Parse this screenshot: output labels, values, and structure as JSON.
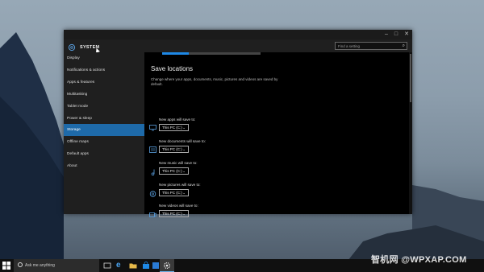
{
  "window": {
    "title": "SYSTEM",
    "buttons": {
      "minimize": "–",
      "maximize": "□",
      "close": "✕"
    },
    "search_placeholder": "Find a setting"
  },
  "sidebar": {
    "items": [
      {
        "label": "Display"
      },
      {
        "label": "Notifications & actions"
      },
      {
        "label": "Apps & features"
      },
      {
        "label": "Multitasking"
      },
      {
        "label": "Tablet mode"
      },
      {
        "label": "Power & sleep"
      },
      {
        "label": "Storage",
        "active": true
      },
      {
        "label": "Offline maps"
      },
      {
        "label": "Default apps"
      },
      {
        "label": "About"
      }
    ]
  },
  "main": {
    "storage_progress": 0.27,
    "section_title": "Save locations",
    "section_desc": "Change where your apps, documents, music, pictures and videos are saved by default.",
    "locations": [
      {
        "label": "New apps will save to:",
        "value": "This PC (C:)",
        "icon": "monitor-icon"
      },
      {
        "label": "New documents will save to:",
        "value": "This PC (C:)",
        "icon": "document-icon"
      },
      {
        "label": "New music will save to:",
        "value": "This PC (C:)",
        "icon": "music-icon"
      },
      {
        "label": "New pictures will save to:",
        "value": "This PC (C:)",
        "icon": "pictures-icon"
      },
      {
        "label": "New videos will save to:",
        "value": "This PC (C:)",
        "icon": "video-icon"
      }
    ],
    "dropdown_arrow": "⌄"
  },
  "taskbar": {
    "search_text": "Ask me anything",
    "watermark": "智机网 @WPXAP.COM"
  },
  "colors": {
    "accent": "#1e6aa9",
    "progress": "#1e88e5",
    "window_bg": "#000000",
    "sidebar_bg": "#1f1f1f"
  }
}
